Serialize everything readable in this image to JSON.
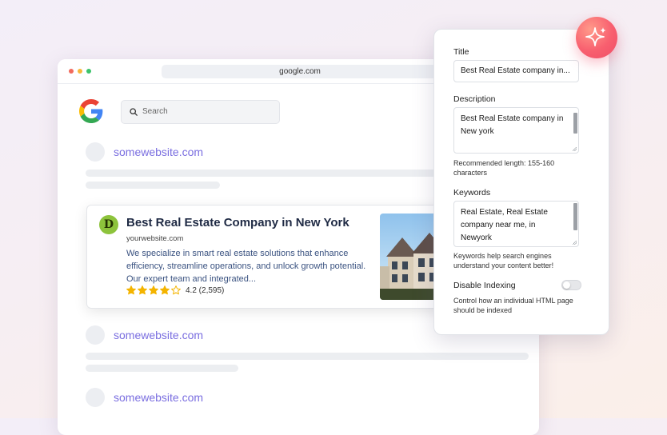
{
  "browser": {
    "url": "google.com",
    "search_placeholder": "Search",
    "sites": [
      "somewebsite.com",
      "somewebsite.com",
      "somewebsite.com"
    ],
    "traffic_light_colors": [
      "#f26a5c",
      "#f7b83b",
      "#3cc36b"
    ]
  },
  "result": {
    "favicon_letter": "D",
    "title": "Best Real Estate Company in New York",
    "url": "yourwebsite.com",
    "description": "We specialize in smart real estate solutions that enhance efficiency, streamline operations, and unlock growth potential. Our expert team and integrated...",
    "rating_text": "4.2 (2,595)",
    "rating_value": 4,
    "rating_max": 5,
    "star_color": "#f4b400"
  },
  "panel": {
    "title_label": "Title",
    "title_value": "Best Real Estate company in...",
    "description_label": "Description",
    "description_value": "Best Real Estate company in New york",
    "description_hint": "Recommended length: 155-160 characters",
    "keywords_label": "Keywords",
    "keywords_value": "Real Estate, Real Estate company near me, in Newyork",
    "keywords_hint": "Keywords help search engines understand your content better!",
    "indexing_label": "Disable Indexing",
    "indexing_hint": "Control how an individual HTML page should be indexed",
    "indexing_enabled": false
  },
  "colors": {
    "accent": "#7a6ee0",
    "sparkle": "#f85f6f",
    "favicon": "#8dc33c"
  }
}
